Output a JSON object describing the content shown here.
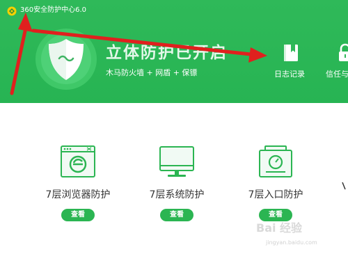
{
  "window": {
    "title": "360安全防护中心6.0"
  },
  "hero": {
    "status_title": "立体防护已开启",
    "subtitle": "木马防火墙 + 网盾 + 保镖"
  },
  "header_actions": [
    {
      "label": "日志记录",
      "icon": "log-book-icon"
    },
    {
      "label": "信任与",
      "icon": "lock-icon"
    }
  ],
  "protection_cards": [
    {
      "label": "7层浏览器防护",
      "button": "查看",
      "icon": "browser-shield-icon"
    },
    {
      "label": "7层系统防护",
      "button": "查看",
      "icon": "monitor-icon"
    },
    {
      "label": "7层入口防护",
      "button": "查看",
      "icon": "entry-gauge-icon"
    }
  ],
  "watermark": {
    "text": "Bai 经验",
    "url": "jingyan.baidu.com"
  },
  "colors": {
    "header_green": "#2fb959",
    "button_green": "#2bb552",
    "annotation_red": "#e0201e"
  }
}
